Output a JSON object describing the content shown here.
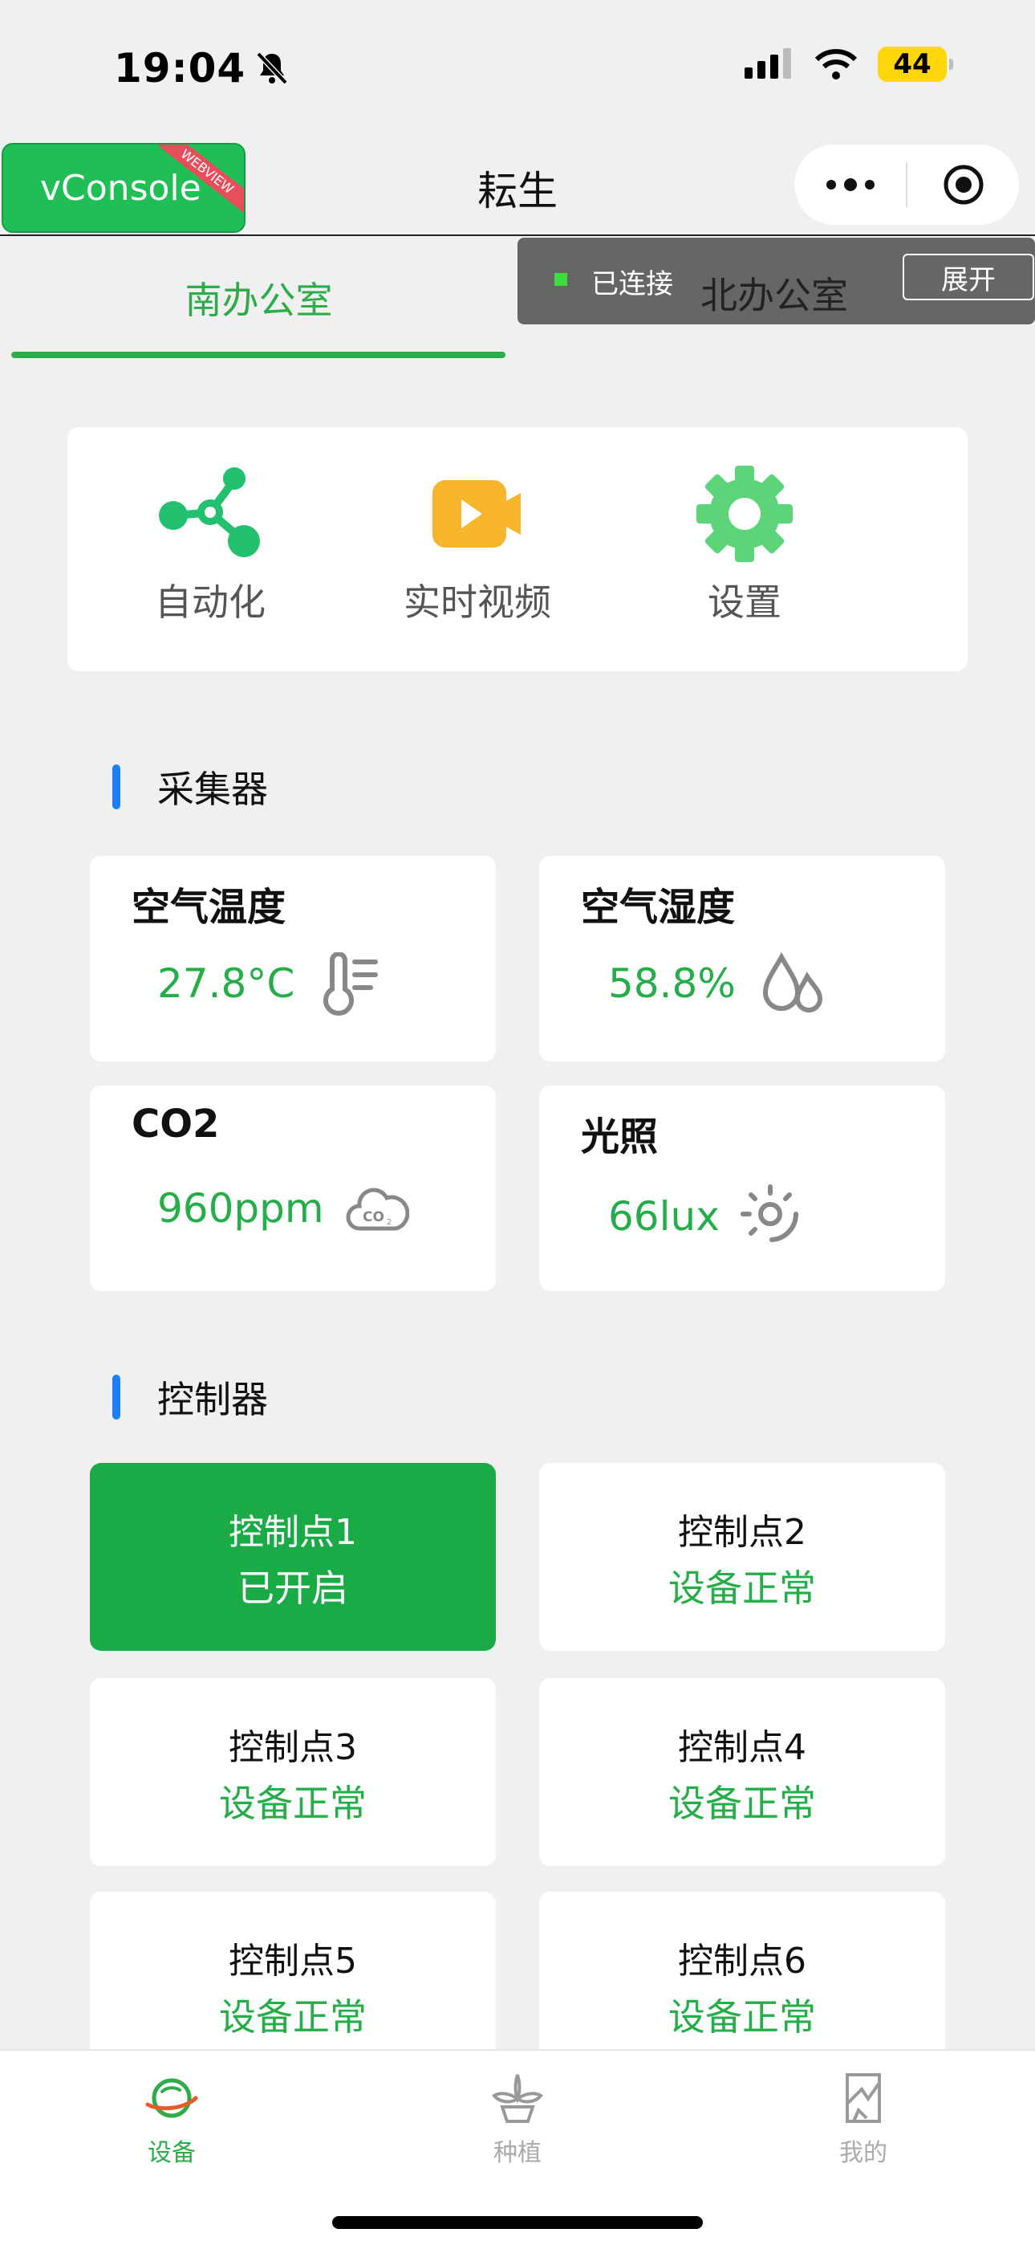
{
  "status_bar": {
    "time": "19:04",
    "battery": "44"
  },
  "nav": {
    "vconsole_label": "vConsole",
    "vconsole_ribbon": "WEBVIEW",
    "title": "耘生"
  },
  "tabs": [
    {
      "label": "南办公室",
      "active": true
    },
    {
      "label": "北办公室",
      "active": false
    }
  ],
  "vconsole_panel": {
    "status": "已连接",
    "expand_label": "展开"
  },
  "quick_actions": [
    {
      "label": "自动化",
      "icon": "automation-node-icon"
    },
    {
      "label": "实时视频",
      "icon": "video-camera-icon"
    },
    {
      "label": "设置",
      "icon": "gear-icon"
    }
  ],
  "collectors": {
    "title": "采集器",
    "items": [
      {
        "label": "空气温度",
        "value": "27.8°C",
        "icon": "thermometer-icon"
      },
      {
        "label": "空气湿度",
        "value": "58.8%",
        "icon": "water-drops-icon"
      },
      {
        "label": "CO2",
        "value": "960ppm",
        "icon": "co2-cloud-icon"
      },
      {
        "label": "光照",
        "value": "66lux",
        "icon": "sun-icon"
      }
    ]
  },
  "controllers": {
    "title": "控制器",
    "items": [
      {
        "name": "控制点1",
        "status": "已开启",
        "on": true
      },
      {
        "name": "控制点2",
        "status": "设备正常",
        "on": false
      },
      {
        "name": "控制点3",
        "status": "设备正常",
        "on": false
      },
      {
        "name": "控制点4",
        "status": "设备正常",
        "on": false
      },
      {
        "name": "控制点5",
        "status": "设备正常",
        "on": false
      },
      {
        "name": "控制点6",
        "status": "设备正常",
        "on": false
      }
    ]
  },
  "tab_bar": [
    {
      "label": "设备",
      "icon": "planet-icon",
      "active": true
    },
    {
      "label": "种植",
      "icon": "sprout-icon",
      "active": false
    },
    {
      "label": "我的",
      "icon": "profile-icon",
      "active": false
    }
  ],
  "colors": {
    "accent_green": "#2eab4a",
    "section_bar_blue": "#1e7ef5",
    "active_control": "#1aab47"
  }
}
